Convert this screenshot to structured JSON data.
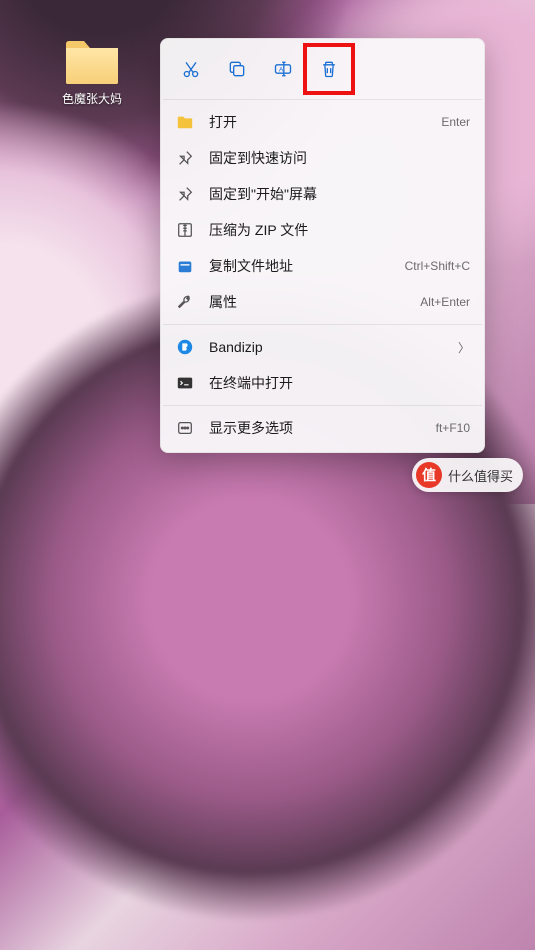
{
  "desktop": {
    "folder_label": "色魔张大妈"
  },
  "icon_row": {
    "cut": "cut-icon",
    "copy": "copy-icon",
    "rename": "rename-icon",
    "delete": "delete-icon"
  },
  "menu": [
    {
      "icon": "folder-fill",
      "label": "打开",
      "shortcut": "Enter"
    },
    {
      "icon": "pin",
      "label": "固定到快速访问",
      "shortcut": ""
    },
    {
      "icon": "pin",
      "label": "固定到\"开始\"屏幕",
      "shortcut": ""
    },
    {
      "icon": "zip",
      "label": "压缩为 ZIP 文件",
      "shortcut": ""
    },
    {
      "icon": "copypath",
      "label": "复制文件地址",
      "shortcut": "Ctrl+Shift+C"
    },
    {
      "icon": "wrench",
      "label": "属性",
      "shortcut": "Alt+Enter"
    }
  ],
  "menu2": [
    {
      "icon": "bandizip",
      "label": "Bandizip",
      "chevron": true
    },
    {
      "icon": "terminal",
      "label": "在终端中打开",
      "shortcut": ""
    }
  ],
  "menu3": [
    {
      "icon": "more",
      "label": "显示更多选项",
      "shortcut": "ft+F10"
    }
  ],
  "badge": {
    "symbol": "值",
    "text": "什么值得买"
  }
}
